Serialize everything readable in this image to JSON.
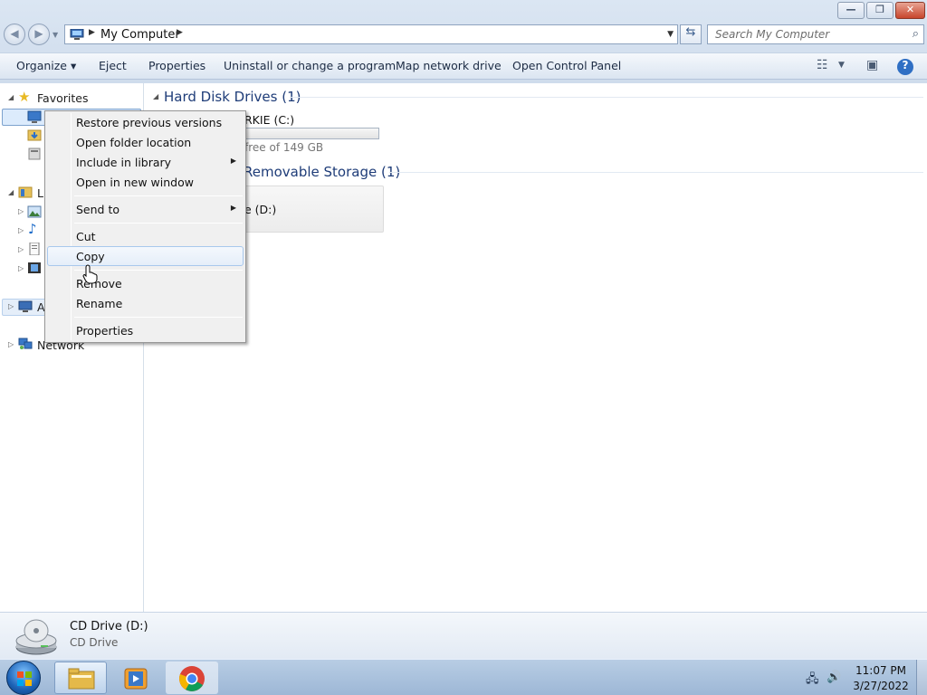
{
  "window": {
    "title_buttons": {
      "minimize": "—",
      "maximize": "❐",
      "close": "✕"
    }
  },
  "address": {
    "crumb": "My Computer",
    "search_placeholder": "Search My Computer"
  },
  "toolbar": {
    "organize": "Organize ▾",
    "eject": "Eject",
    "properties": "Properties",
    "uninstall": "Uninstall or change a program",
    "map_drive": "Map network drive",
    "control_panel": "Open Control Panel"
  },
  "nav": {
    "favorites": "Favorites",
    "libraries": "Li",
    "computer": "A",
    "network": "Network"
  },
  "content": {
    "hdd_header": "Hard Disk Drives (1)",
    "hdd_name": "RKIE (C:)",
    "hdd_free": "free of 149 GB",
    "removable_header": "Removable Storage (1)",
    "removable_name": "e (D:)"
  },
  "context_menu": {
    "items": [
      "Restore previous versions",
      "Open folder location",
      "Include in library",
      "Open in new window",
      "Send to",
      "Cut",
      "Copy",
      "Remove",
      "Rename",
      "Properties"
    ],
    "highlighted": "Copy"
  },
  "details": {
    "name": "CD Drive (D:)",
    "type": "CD Drive"
  },
  "taskbar": {
    "time": "11:07 PM",
    "date": "3/27/2022"
  },
  "colors": {
    "group_header": "#1e3c78",
    "accent": "#3c7fd1",
    "taskbar": "#a8c0dc"
  }
}
